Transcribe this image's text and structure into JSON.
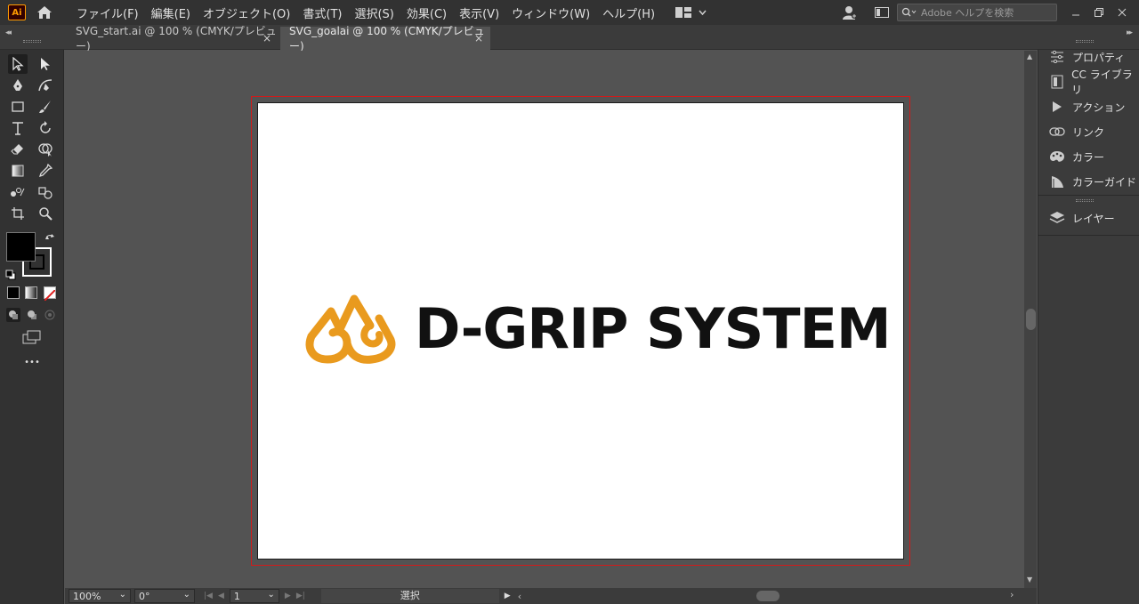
{
  "menubar": {
    "app_logo": "Ai",
    "items": [
      "ファイル(F)",
      "編集(E)",
      "オブジェクト(O)",
      "書式(T)",
      "選択(S)",
      "効果(C)",
      "表示(V)",
      "ウィンドウ(W)",
      "ヘルプ(H)"
    ],
    "search_placeholder": "Adobe ヘルプを検索"
  },
  "tabs": [
    {
      "label": "SVG_start.ai @ 100 % (CMYK/プレビュー)",
      "close": "×",
      "active": false
    },
    {
      "label": "SVG_goalai @ 100 % (CMYK/プレビュー)",
      "close": "×",
      "active": true
    }
  ],
  "artboard": {
    "logo_text": "D-GRIP SYSTEM",
    "logo_color": "#E99A1E"
  },
  "statusbar": {
    "zoom": "100%",
    "rotation": "0°",
    "artboard_num": "1",
    "status": "選択"
  },
  "panels": [
    {
      "label": "プロパティ",
      "icon": "properties-icon"
    },
    {
      "label": "CC ライブラリ",
      "icon": "libraries-icon"
    },
    {
      "label": "アクション",
      "icon": "play-icon"
    },
    {
      "label": "リンク",
      "icon": "link-icon"
    },
    {
      "label": "カラー",
      "icon": "palette-icon"
    },
    {
      "label": "カラーガイド",
      "icon": "color-guide-icon"
    },
    {
      "label": "レイヤー",
      "icon": "layers-icon"
    }
  ],
  "toolbar": {
    "more_label": "•••"
  }
}
